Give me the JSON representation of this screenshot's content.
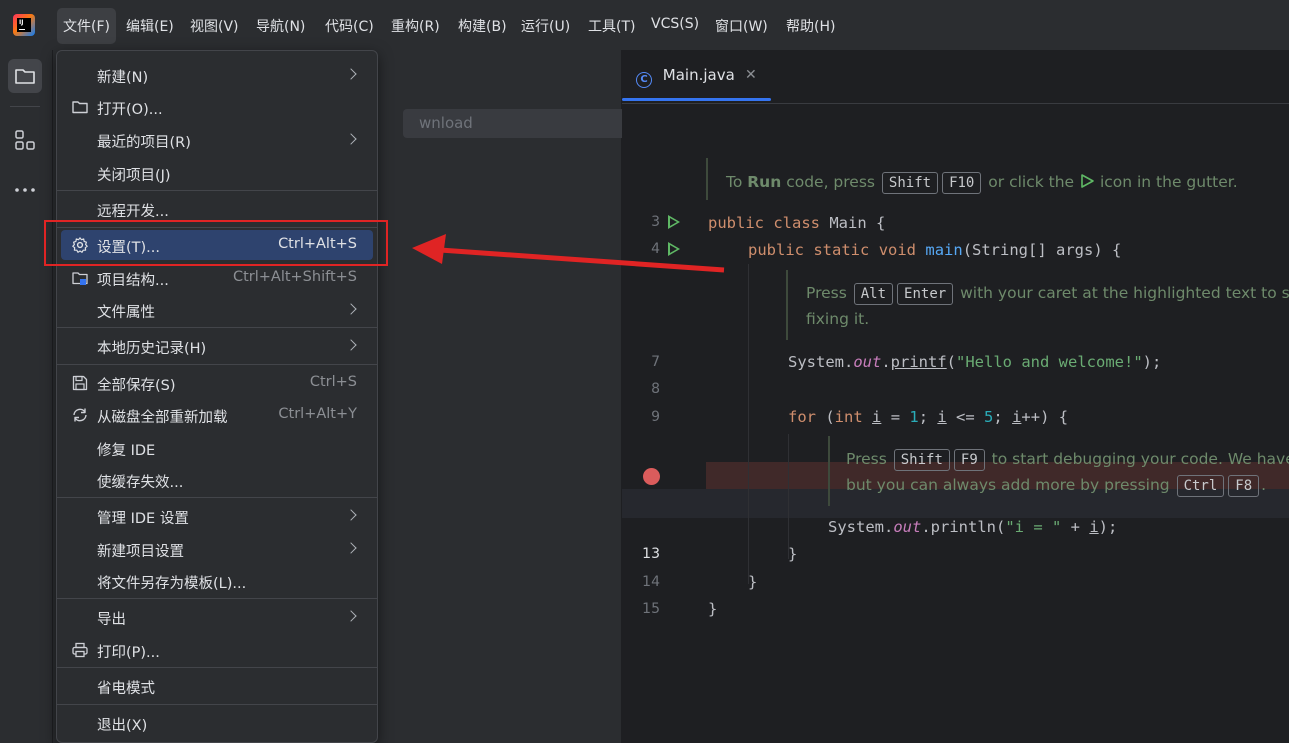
{
  "menubar": {
    "items": [
      "文件(F)",
      "编辑(E)",
      "视图(V)",
      "导航(N)",
      "代码(C)",
      "重构(R)",
      "构建(B)",
      "运行(U)",
      "工具(T)",
      "VCS(S)",
      "窗口(W)",
      "帮助(H)"
    ]
  },
  "project": {
    "search_text": "wnload"
  },
  "file_menu": {
    "items": [
      {
        "label": "新建(N)",
        "shortcut": "",
        "submenu": true,
        "icon": ""
      },
      {
        "label": "打开(O)...",
        "shortcut": "",
        "submenu": false,
        "icon": "folder-icon"
      },
      {
        "label": "最近的项目(R)",
        "shortcut": "",
        "submenu": true,
        "icon": ""
      },
      {
        "label": "关闭项目(J)",
        "shortcut": "",
        "submenu": false,
        "icon": ""
      },
      {
        "label": "远程开发...",
        "shortcut": "",
        "submenu": false,
        "icon": ""
      },
      {
        "label": "设置(T)...",
        "shortcut": "Ctrl+Alt+S",
        "submenu": false,
        "icon": "gear-icon",
        "highlighted": true
      },
      {
        "label": "项目结构...",
        "shortcut": "Ctrl+Alt+Shift+S",
        "submenu": false,
        "icon": "project-structure-icon"
      },
      {
        "label": "文件属性",
        "shortcut": "",
        "submenu": true,
        "icon": ""
      },
      {
        "label": "本地历史记录(H)",
        "shortcut": "",
        "submenu": true,
        "icon": ""
      },
      {
        "label": "全部保存(S)",
        "shortcut": "Ctrl+S",
        "submenu": false,
        "icon": "save-icon"
      },
      {
        "label": "从磁盘全部重新加载",
        "shortcut": "Ctrl+Alt+Y",
        "submenu": false,
        "icon": "reload-icon"
      },
      {
        "label": "修复 IDE",
        "shortcut": "",
        "submenu": false,
        "icon": ""
      },
      {
        "label": "使缓存失效...",
        "shortcut": "",
        "submenu": false,
        "icon": ""
      },
      {
        "label": "管理 IDE 设置",
        "shortcut": "",
        "submenu": true,
        "icon": ""
      },
      {
        "label": "新建项目设置",
        "shortcut": "",
        "submenu": true,
        "icon": ""
      },
      {
        "label": "将文件另存为模板(L)...",
        "shortcut": "",
        "submenu": false,
        "icon": ""
      },
      {
        "label": "导出",
        "shortcut": "",
        "submenu": true,
        "icon": ""
      },
      {
        "label": "打印(P)...",
        "shortcut": "",
        "submenu": false,
        "icon": "printer-icon"
      },
      {
        "label": "省电模式",
        "shortcut": "",
        "submenu": false,
        "icon": ""
      },
      {
        "label": "退出(X)",
        "shortcut": "",
        "submenu": false,
        "icon": ""
      }
    ]
  },
  "editor": {
    "tab_label": "Main.java",
    "tab_icon_letter": "C",
    "line_numbers": [
      "3",
      "4",
      "7",
      "8",
      "9",
      "13",
      "14",
      "15"
    ],
    "hint1": {
      "pre": "To ",
      "run": "Run",
      "mid": " code, press ",
      "k1": "Shift",
      "k2": "F10",
      "post": " or click the ",
      "post2": " icon in the gutter."
    },
    "hint2": {
      "pre": "Press ",
      "k1": "Alt",
      "k2": "Enter",
      "post": " with your caret at the highlighted text to s",
      "line2": "fixing it."
    },
    "hint3": {
      "pre": "Press ",
      "k1": "Shift",
      "k2": "F9",
      "post": " to start debugging your code. We have",
      "line2pre": "but you can always add more by pressing ",
      "k3": "Ctrl",
      "k4": "F8",
      "line2post": "."
    },
    "code": {
      "public": "public",
      "class": "class",
      "main_cls": " Main {",
      "static": "static",
      "void": "void",
      "main_fn": "main",
      "args": "(String[] args) {",
      "system": "System.",
      "out": "out",
      "printf": "printf",
      "hello": "\"Hello and welcome!\"",
      "close1": ");",
      "for": "for",
      "int": "int",
      "i": "i",
      "eq": " = ",
      "one": "1",
      "le": " <= ",
      "five": "5",
      "inc": "++) {",
      "println": ".println(",
      "istr": "\"i = \"",
      "plus": " + ",
      "close2": ");",
      "brace": "}"
    }
  }
}
